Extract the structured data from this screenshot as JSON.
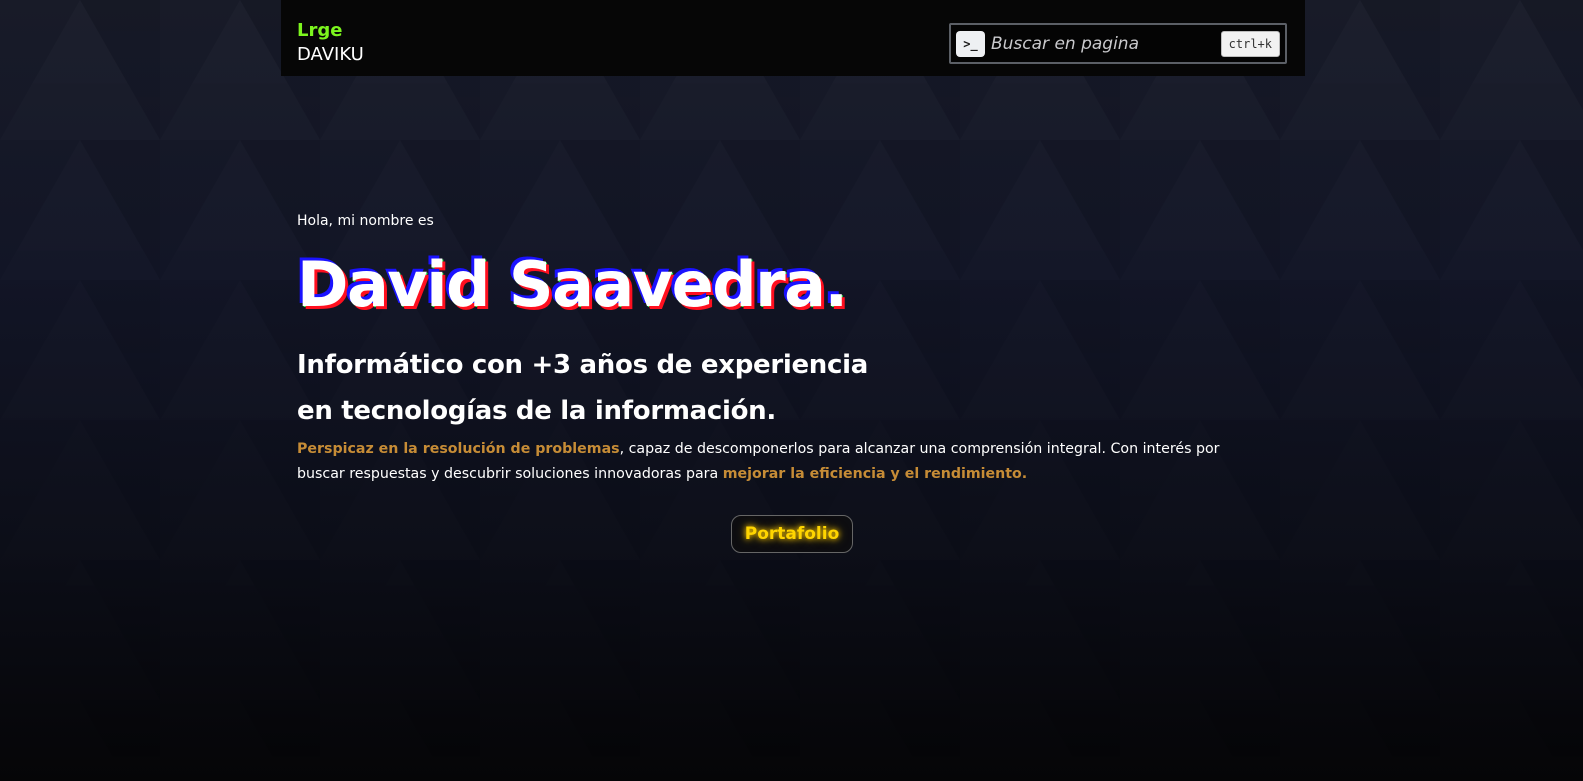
{
  "colors": {
    "brand_accent": "#7cf51e",
    "highlight": "#c68c36",
    "cta_text": "#ffd500",
    "header_bg": "#060606"
  },
  "header": {
    "brand_top": "Lrge",
    "brand_bottom": "DAVIKU",
    "search": {
      "icon": "terminal-icon",
      "icon_glyph": ">_",
      "placeholder": "Buscar en pagina",
      "shortcut": "ctrl+k"
    }
  },
  "hero": {
    "greeting": "Hola, mi nombre es",
    "name": "David Saavedra.",
    "subtitle_line1": "Informático con +3 años de experiencia",
    "subtitle_line2": "en tecnologías de la información.",
    "description": {
      "highlight1": "Perspicaz en la resolución de problemas",
      "text1": ", capaz de descomponerlos para alcanzar una comprensión integral. Con interés por buscar respuestas y descubrir soluciones innovadoras para ",
      "highlight2": "mejorar la eficiencia y el rendimiento."
    },
    "cta_label": "Portafolio"
  }
}
